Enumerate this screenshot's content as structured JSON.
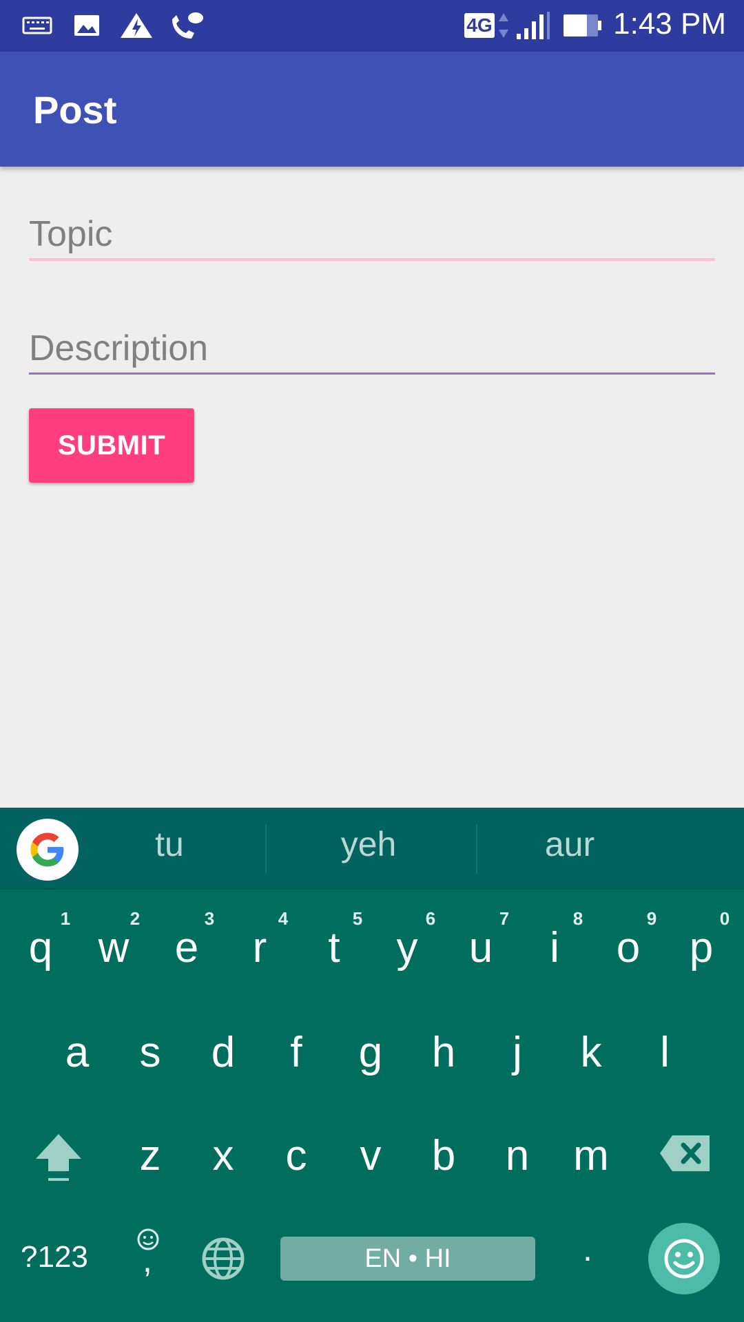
{
  "status_bar": {
    "time": "1:43 PM",
    "network": "4G",
    "icons": [
      "keyboard-icon",
      "image-icon",
      "warning-bolt-icon",
      "wifi-calling-icon",
      "network-arrows-icon",
      "signal-icon",
      "battery-icon"
    ]
  },
  "app_bar": {
    "title": "Post"
  },
  "form": {
    "topic": {
      "placeholder": "Topic",
      "value": "",
      "underline_color": "#ffc0cb"
    },
    "description": {
      "placeholder": "Description",
      "value": "",
      "underline_color": "#9c6dbe"
    },
    "submit_label": "SUBMIT",
    "submit_color": "#ff3d7f"
  },
  "keyboard": {
    "suggestions": [
      "tu",
      "yeh",
      "aur"
    ],
    "row1": [
      "q",
      "w",
      "e",
      "r",
      "t",
      "y",
      "u",
      "i",
      "o",
      "p"
    ],
    "row1_hints": [
      "1",
      "2",
      "3",
      "4",
      "5",
      "6",
      "7",
      "8",
      "9",
      "0"
    ],
    "row2": [
      "a",
      "s",
      "d",
      "f",
      "g",
      "h",
      "j",
      "k",
      "l"
    ],
    "row3": [
      "z",
      "x",
      "c",
      "v",
      "b",
      "n",
      "m"
    ],
    "symbols_label": "?123",
    "comma_label": ",",
    "period_label": ".",
    "space_label": "EN • HI",
    "icons": [
      "google-icon",
      "shift-icon",
      "backspace-icon",
      "emoji-small-icon",
      "globe-icon",
      "emoji-icon"
    ],
    "colors": {
      "background": "#006e5e",
      "suggestion_bar": "#01625f",
      "space": "#72ada3",
      "emoji_key": "#4cbba7"
    }
  }
}
